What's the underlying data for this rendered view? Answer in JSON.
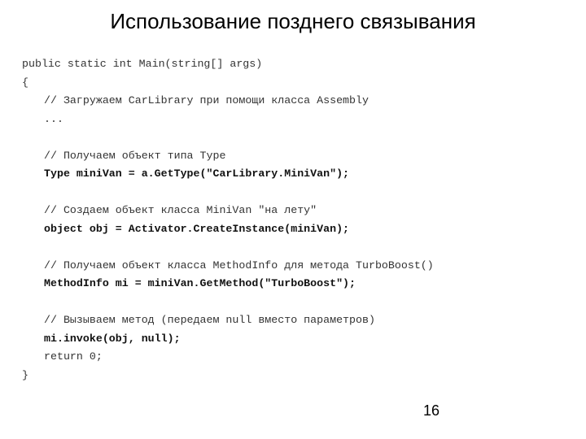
{
  "slide": {
    "title": "Использование позднего связывания",
    "page_number": "16",
    "code_lines": [
      {
        "text": "public static int Main(string[] args)",
        "indent": 0,
        "bold": false,
        "kind": "code"
      },
      {
        "text": "{",
        "indent": 0,
        "bold": false,
        "kind": "code"
      },
      {
        "text": "// Загружаем CarLibrary при помощи класса Assembly",
        "indent": 1,
        "bold": false,
        "kind": "comment"
      },
      {
        "text": "...",
        "indent": 1,
        "bold": false,
        "kind": "code"
      },
      {
        "text": "",
        "indent": 0,
        "bold": false,
        "kind": "blank"
      },
      {
        "text": "// Получаем объект типа Type",
        "indent": 1,
        "bold": false,
        "kind": "comment"
      },
      {
        "text": "Type miniVan = a.GetType(\"CarLibrary.MiniVan\");",
        "indent": 1,
        "bold": true,
        "kind": "code"
      },
      {
        "text": "",
        "indent": 0,
        "bold": false,
        "kind": "blank"
      },
      {
        "text": "// Создаем объект класса MiniVan \"на лету\"",
        "indent": 1,
        "bold": false,
        "kind": "comment"
      },
      {
        "text": "object obj = Activator.CreateInstance(miniVan);",
        "indent": 1,
        "bold": true,
        "kind": "code"
      },
      {
        "text": "",
        "indent": 0,
        "bold": false,
        "kind": "blank"
      },
      {
        "text": "// Получаем объект класса MethodInfo для метода TurboBoost()",
        "indent": 1,
        "bold": false,
        "kind": "comment"
      },
      {
        "text": "MethodInfo mi = miniVan.GetMethod(\"TurboBoost\");",
        "indent": 1,
        "bold": true,
        "kind": "code"
      },
      {
        "text": "",
        "indent": 0,
        "bold": false,
        "kind": "blank"
      },
      {
        "text": "// Вызываем метод (передаем null вместо параметров)",
        "indent": 1,
        "bold": false,
        "kind": "comment"
      },
      {
        "text": "mi.invoke(obj, null);",
        "indent": 1,
        "bold": true,
        "kind": "code"
      },
      {
        "text": "return 0;",
        "indent": 1,
        "bold": false,
        "kind": "code"
      },
      {
        "text": "}",
        "indent": 0,
        "bold": false,
        "kind": "code"
      }
    ]
  }
}
